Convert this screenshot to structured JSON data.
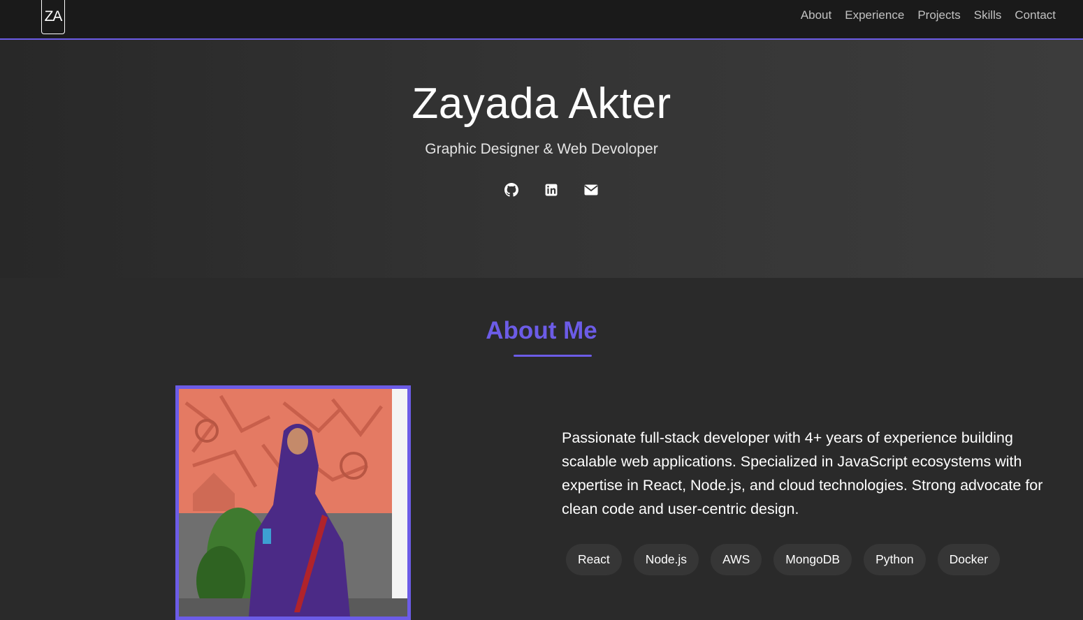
{
  "navbar": {
    "logo": "ZA",
    "links": [
      "About",
      "Experience",
      "Projects",
      "Skills",
      "Contact"
    ]
  },
  "hero": {
    "name": "Zayada Akter",
    "subtitle": "Graphic Designer & Web Devoloper",
    "socials": [
      "github-icon",
      "linkedin-icon",
      "envelope-icon"
    ]
  },
  "about": {
    "title": "About Me",
    "description": "Passionate full-stack developer with 4+ years of experience building scalable web applications. Specialized in JavaScript ecosystems with expertise in React, Node.js, and cloud technologies. Strong advocate for clean code and user-centric design.",
    "skills": [
      "React",
      "Node.js",
      "AWS",
      "MongoDB",
      "Python",
      "Docker"
    ]
  },
  "colors": {
    "accent": "#6c5ce7",
    "navbar_bg": "#1a1a1a",
    "page_bg": "#2a2a2a",
    "pill_bg": "#363636"
  }
}
